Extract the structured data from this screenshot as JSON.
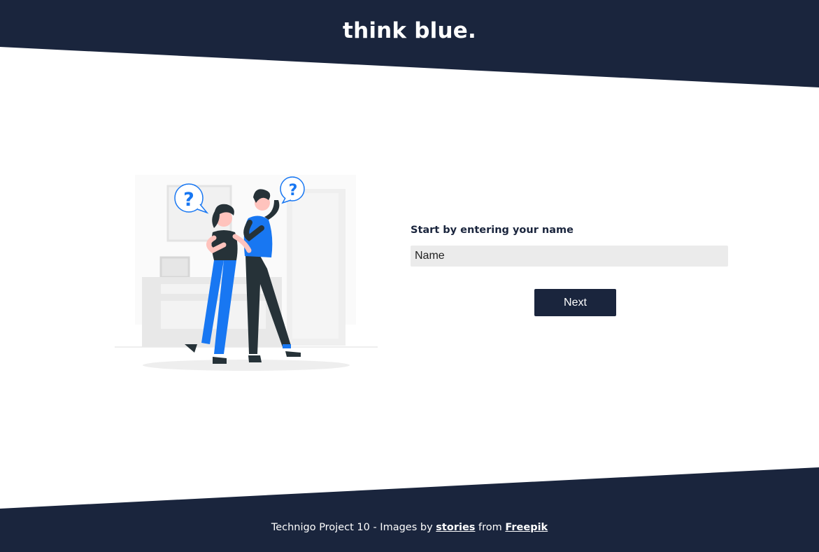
{
  "colors": {
    "brand_dark": "#1a253d",
    "accent_blue": "#1877f2",
    "input_bg": "#ebebeb"
  },
  "header": {
    "title": "think blue."
  },
  "illustration": {
    "icon": "people-question-illustration",
    "bubble_text": "?"
  },
  "form": {
    "label": "Start by entering your name",
    "name_input": {
      "value": "",
      "placeholder": "Name"
    },
    "next_label": "Next"
  },
  "footer": {
    "prefix": "Technigo Project 10 - Images by ",
    "link1": "stories",
    "middle": " from ",
    "link2": "Freepik"
  }
}
